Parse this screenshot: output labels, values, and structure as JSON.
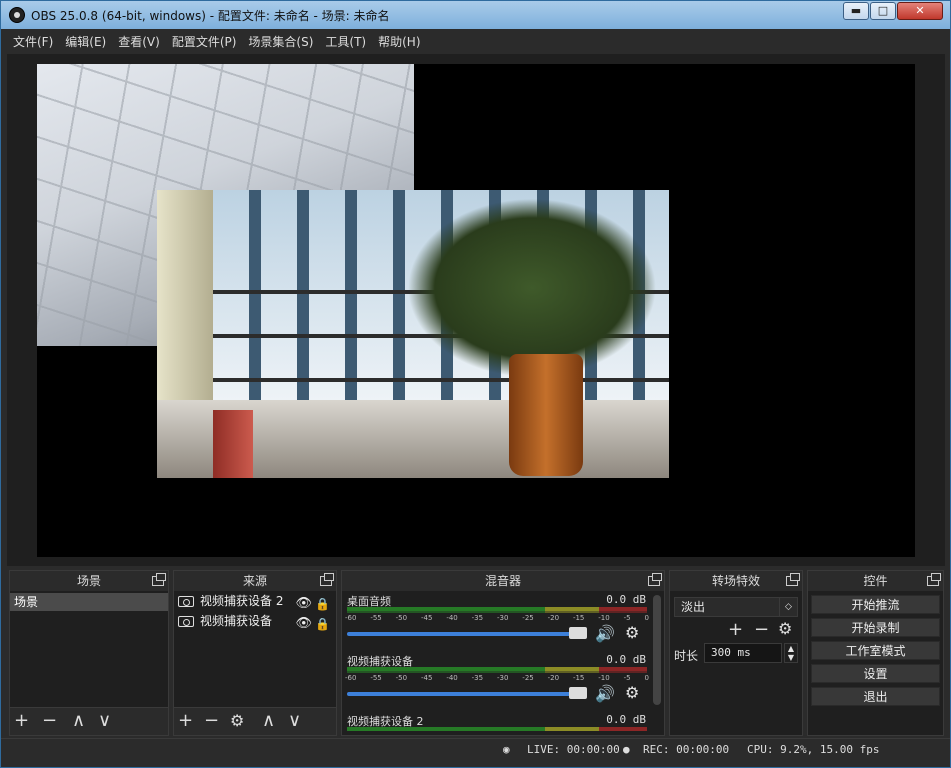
{
  "window": {
    "title": "OBS 25.0.8 (64-bit, windows) - 配置文件: 未命名 - 场景: 未命名",
    "min": "▬",
    "max": "□",
    "close": "✕"
  },
  "menu": [
    "文件(F)",
    "编辑(E)",
    "查看(V)",
    "配置文件(P)",
    "场景集合(S)",
    "工具(T)",
    "帮助(H)"
  ],
  "docks": {
    "scenes": {
      "title": "场景",
      "items": [
        "场景"
      ]
    },
    "sources": {
      "title": "来源",
      "items": [
        "视频捕获设备 2",
        "视频捕获设备"
      ]
    },
    "mixer": {
      "title": "混音器",
      "channels": [
        {
          "name": "桌面音频",
          "db": "0.0 dB"
        },
        {
          "name": "视频捕获设备",
          "db": "0.0 dB"
        },
        {
          "name": "视频捕获设备 2",
          "db": "0.0 dB"
        }
      ],
      "ticks": [
        "-60",
        "-55",
        "-50",
        "-45",
        "-40",
        "-35",
        "-30",
        "-25",
        "-20",
        "-15",
        "-10",
        "-5",
        "0"
      ]
    },
    "transitions": {
      "title": "转场特效",
      "selected": "淡出",
      "duration_label": "时长",
      "duration": "300 ms"
    },
    "controls": {
      "title": "控件",
      "buttons": [
        "开始推流",
        "开始录制",
        "工作室模式",
        "设置",
        "退出"
      ]
    }
  },
  "icons": {
    "add": "+",
    "remove": "−",
    "up": "∧",
    "down": "∨",
    "gear": "⚙",
    "eye": "👁",
    "lock": "🔒",
    "speaker": "🔊",
    "live": "◉",
    "rec": "●"
  },
  "status": {
    "live": "LIVE: 00:00:00",
    "rec": "REC: 00:00:00",
    "cpu": "CPU: 9.2%, 15.00 fps"
  },
  "colors": {
    "accent": "#3d80d9",
    "background": "#2b2b2b"
  }
}
